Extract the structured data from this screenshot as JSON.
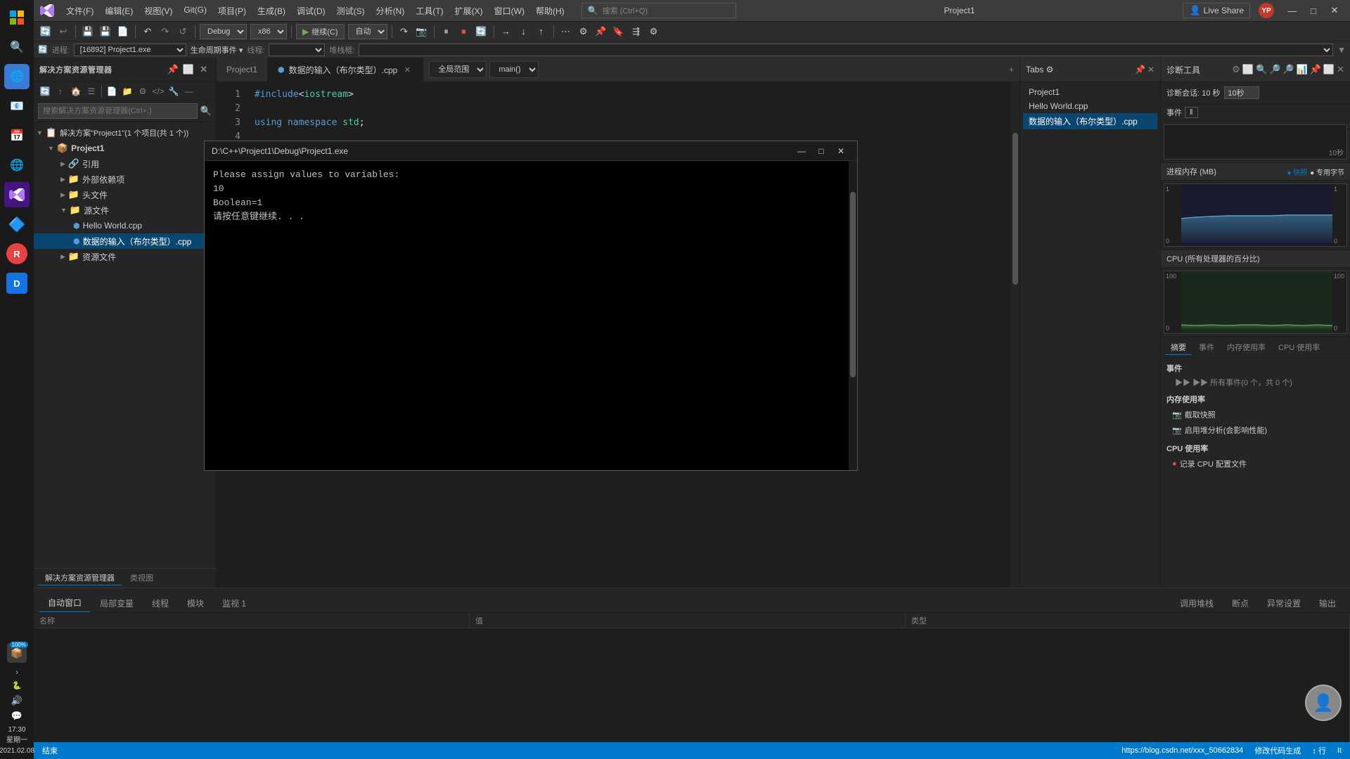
{
  "titlebar": {
    "menus": [
      "文件(F)",
      "编辑(E)",
      "视图(V)",
      "Git(G)",
      "项目(P)",
      "生成(B)",
      "调试(D)",
      "测试(S)",
      "分析(N)",
      "工具(T)",
      "扩展(X)",
      "窗口(W)",
      "帮助(H)"
    ],
    "search_placeholder": "搜索 (Ctrl+Q)",
    "project_name": "Project1",
    "avatar_letter": "YP",
    "minimize": "—",
    "maximize": "□",
    "close": "✕"
  },
  "toolbar": {
    "debug_config": "Debug",
    "platform": "x86",
    "continue_label": "继续(C)",
    "auto_label": "自动",
    "live_share_label": "Live Share"
  },
  "debug_bar": {
    "process_label": "进程:",
    "process_value": "[16892] Project1.exe",
    "lifecycle_label": "生命周期事件 ▾",
    "thread_label": "线程:",
    "stack_label": "堆栈框:"
  },
  "explorer": {
    "title": "解决方案资源管理器",
    "search_placeholder": "搜索解决方案资源管理器(Ctrl+;)",
    "solution_label": "解决方案\"Project1\"(1 个项目(共 1 个))",
    "project_name": "Project1",
    "nodes": [
      {
        "label": "引用",
        "indent": 2,
        "has_arrow": true
      },
      {
        "label": "外部依赖项",
        "indent": 2,
        "has_arrow": true
      },
      {
        "label": "头文件",
        "indent": 2,
        "has_arrow": true
      },
      {
        "label": "源文件",
        "indent": 2,
        "expanded": true
      },
      {
        "label": "Hello World.cpp",
        "indent": 3,
        "is_file": true
      },
      {
        "label": "数据的输入（布尔类型）.cpp",
        "indent": 3,
        "is_file": true,
        "active": true
      },
      {
        "label": "资源文件",
        "indent": 2,
        "has_arrow": true
      }
    ]
  },
  "editor": {
    "tab_filename": "数据的输入（布尔类型）.cpp",
    "breadcrumb_parts": [
      "Project1",
      "全局范围",
      "main()"
    ],
    "code_lines": [
      {
        "num": "1",
        "text": "#include<iostream>"
      },
      {
        "num": "2",
        "text": ""
      },
      {
        "num": "3",
        "text": "using namespace std;"
      },
      {
        "num": "4",
        "text": ""
      }
    ]
  },
  "tabs_panel": {
    "title": "Tabs ⚙",
    "items": [
      "Project1",
      "Hello World.cpp",
      "数据的输入（布尔类型）.cpp"
    ]
  },
  "console_window": {
    "title": "D:\\C++\\Project1\\Debug\\Project1.exe",
    "lines": [
      "Please assign values to variables:",
      "10",
      "Boolean=1",
      "请按任意键继续. . ."
    ]
  },
  "diag_panel": {
    "title": "诊断工具",
    "session_label": "诊断会话: 10 秒",
    "session_value": "10秒",
    "events_label": "事件",
    "pause_label": "‖",
    "memory_label": "进程内存 (MB)",
    "memory_y_max": "1",
    "memory_y_mid": "",
    "memory_y_min": "0",
    "cpu_label": "CPU (所有处理器的百分比)",
    "cpu_y_max": "100",
    "cpu_y_min": "0",
    "cpu_right_max": "100",
    "cpu_right_min": "0",
    "tabs": [
      "摘要",
      "事件",
      "内存使用率",
      "CPU 使用率"
    ],
    "active_tab": "摘要",
    "events_section": {
      "label": "事件",
      "items": [
        "▶▶ 所有事件(0 个，共 0 个)"
      ]
    },
    "memory_section": {
      "label": "内存使用率",
      "actions": [
        {
          "icon": "📷",
          "label": "截取快照"
        },
        {
          "icon": "📷",
          "label": "启用堆分析(会影响性能)"
        }
      ]
    },
    "cpu_section": {
      "label": "CPU 使用率",
      "actions": [
        {
          "icon": "●",
          "label": "记录 CPU 配置文件"
        }
      ]
    }
  },
  "bottom_panel": {
    "tabs": [
      "自动窗口",
      "局部变量",
      "线程",
      "模块",
      "监视 1"
    ],
    "active_tab": "自动窗口",
    "cols": [
      "名称",
      "值",
      "类型"
    ],
    "right_tabs": [
      "调用堆栈",
      "断点",
      "异常设置",
      "输出"
    ]
  },
  "status_bar": {
    "left_items": [
      "结束"
    ],
    "right_items": [
      "↕ 行",
      "It"
    ],
    "url": "https://blog.csdn.net/xxx_50662834"
  },
  "taskbar": {
    "search_icon": "🔍",
    "icons": [
      "⊞",
      "🔍",
      "🌐",
      "📧",
      "📅",
      "🌐",
      "🔵",
      "🌀",
      "D"
    ],
    "bottom_icons": [
      "🔊",
      "📦",
      "💬"
    ],
    "time": "17:30",
    "weekday": "星期一",
    "date": "2021.02.08"
  }
}
